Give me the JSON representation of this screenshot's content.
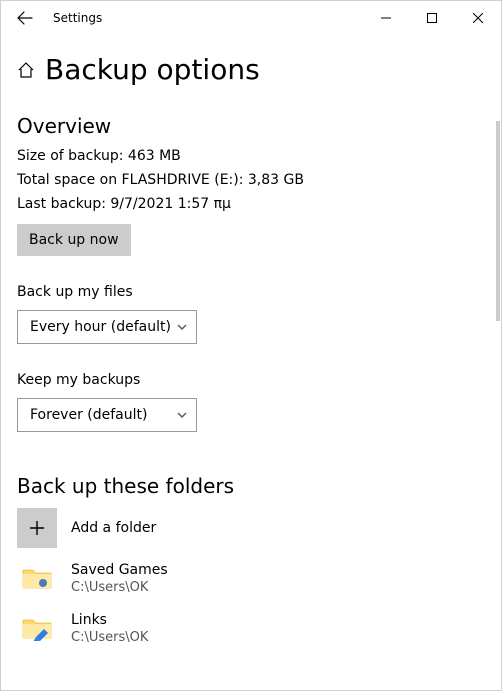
{
  "window": {
    "app_name": "Settings"
  },
  "page": {
    "title": "Backup options"
  },
  "overview": {
    "heading": "Overview",
    "size_label": "Size of backup:",
    "size_value": "463 MB",
    "total_label": "Total space on FLASHDRIVE (E:):",
    "total_value": "3,83 GB",
    "last_label": "Last backup:",
    "last_value": "9/7/2021 1:57 πμ",
    "backup_now_label": "Back up now"
  },
  "frequency": {
    "label": "Back up my files",
    "value": "Every hour (default)"
  },
  "retention": {
    "label": "Keep my backups",
    "value": "Forever (default)"
  },
  "folders": {
    "heading": "Back up these folders",
    "add_label": "Add a folder",
    "items": [
      {
        "name": "Saved Games",
        "path": "C:\\Users\\OK"
      },
      {
        "name": "Links",
        "path": "C:\\Users\\OK"
      }
    ]
  }
}
